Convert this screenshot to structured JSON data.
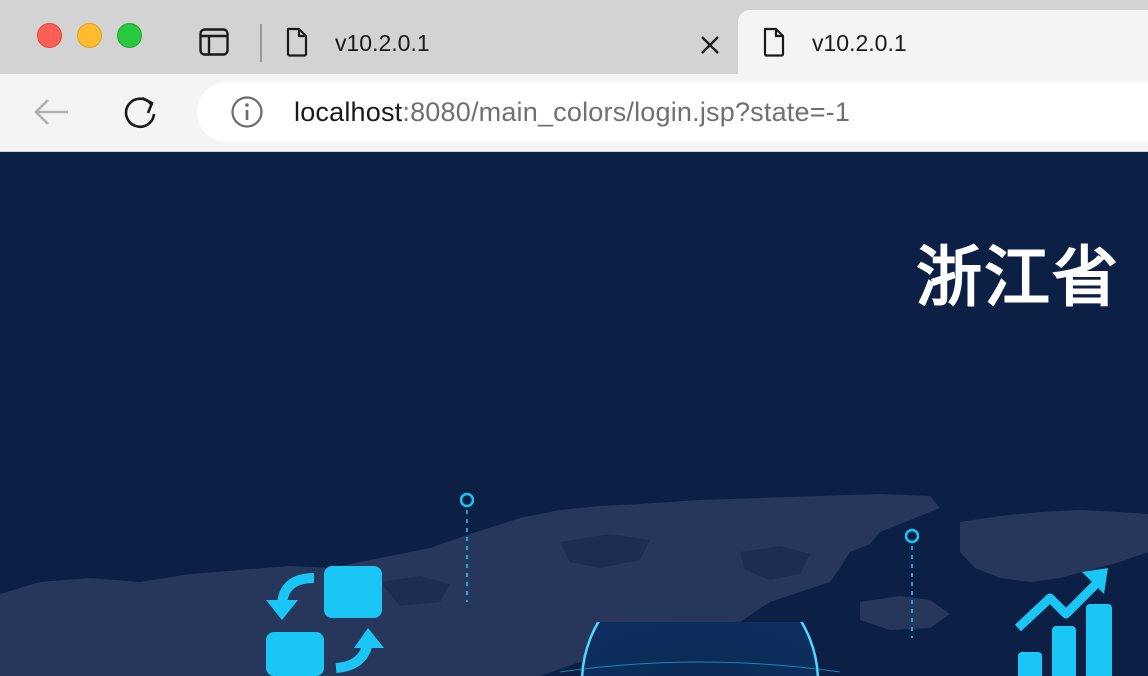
{
  "window": {
    "controls": [
      "close",
      "minimize",
      "maximize"
    ]
  },
  "tabs": [
    {
      "title": "v10.2.0.1",
      "active": false,
      "icon": "document-icon"
    },
    {
      "title": "v10.2.0.1",
      "active": true,
      "icon": "document-icon"
    }
  ],
  "toolbar": {
    "back_icon": "arrow-left-icon",
    "reload_icon": "reload-icon",
    "url_host": "localhost",
    "url_rest": ":8080/main_colors/login.jsp?state=-1",
    "info_icon": "info-icon"
  },
  "page": {
    "title": "浙江省",
    "colors": {
      "background": "#0c1f45",
      "map": "#27375c",
      "accent": "#19c6f5"
    }
  }
}
